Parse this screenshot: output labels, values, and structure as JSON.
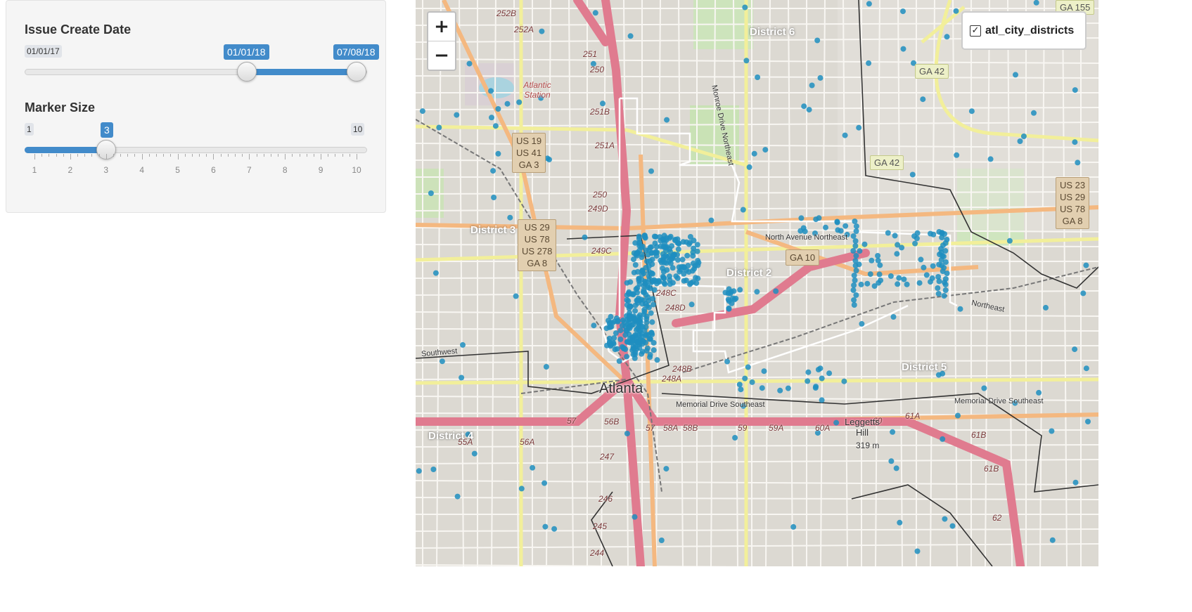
{
  "sidebar": {
    "date_slider": {
      "label": "Issue Create Date",
      "min_label": "01/01/17",
      "from_label": "01/01/18",
      "to_label": "07/08/18",
      "from_fraction": 0.65,
      "to_fraction": 1.0
    },
    "size_slider": {
      "label": "Marker Size",
      "min_label": "1",
      "max_label": "10",
      "value_label": "3",
      "value": 3,
      "ticks": [
        "1",
        "2",
        "3",
        "4",
        "5",
        "6",
        "7",
        "8",
        "9",
        "10"
      ]
    }
  },
  "map": {
    "zoom_in": "+",
    "zoom_out": "−",
    "layer_toggle": {
      "checked": true,
      "label": "atl_city_districts",
      "check_glyph": "✓"
    },
    "districts": [
      "District 6",
      "District 3",
      "District 2",
      "District 4",
      "District 5"
    ],
    "city_label": "Atlanta",
    "shields": {
      "us19": "US 19\nUS 41\nGA 3",
      "us29a": "US 29\nUS 78\nUS 278\nGA 8",
      "us23": "US 23\nUS 29\nUS 78\nGA 8",
      "ga42a": "GA 42",
      "ga42b": "GA 42",
      "ga10": "GA 10",
      "ga155": "GA 155"
    },
    "road_labels": {
      "north_ave": "North Avenue Northeast",
      "memorial_w": "Memorial Drive Southeast",
      "memorial_e": "Memorial Drive Southeast",
      "monroe": "Monroe Drive Northeast",
      "ne_road": "Northeast",
      "southwest": "Southwest",
      "leggetts": "Leggetts Hill",
      "elev": "319 m",
      "atlantic": "Atlantic Station"
    },
    "exits": [
      "252B",
      "252A",
      "251",
      "250",
      "251B",
      "251A",
      "250",
      "249D",
      "249C",
      "248C",
      "248D",
      "248B",
      "248A",
      "57",
      "56B",
      "56A",
      "55A",
      "57",
      "58A",
      "58B",
      "59",
      "59A",
      "60A",
      "60",
      "61A",
      "61B",
      "61B",
      "62",
      "247",
      "246",
      "245",
      "244"
    ],
    "colors": {
      "marker": "#1f8ec0",
      "district_border": "#ffffff",
      "boundary": "#333333",
      "interstate": "#e07b8f",
      "primary": "#f4b880",
      "secondary": "#f6f6b8"
    }
  }
}
